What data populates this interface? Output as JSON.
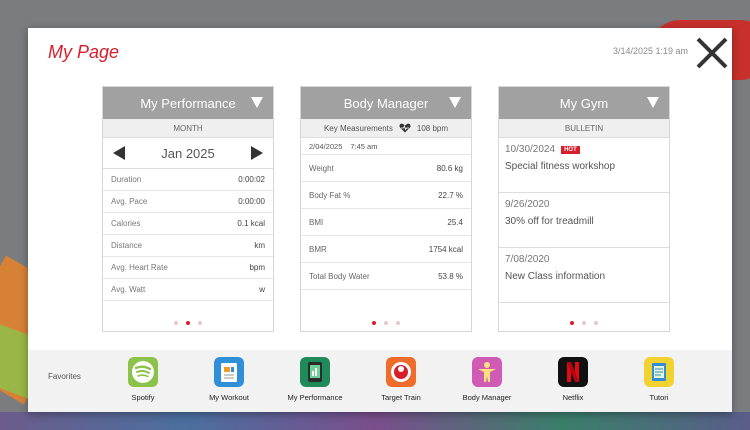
{
  "modal": {
    "title": "My Page",
    "datetime": "3/14/2025 1:19 am"
  },
  "performance": {
    "title": "My Performance",
    "subheader": "MONTH",
    "month": "Jan 2025",
    "rows": [
      {
        "label": "Duration",
        "value": "0:00:02"
      },
      {
        "label": "Avg. Pace",
        "value": "0:00:00"
      },
      {
        "label": "Calories",
        "value": "0.1 kcal"
      },
      {
        "label": "Distance",
        "value": "km"
      },
      {
        "label": "Avg. Heart Rate",
        "value": "bpm"
      },
      {
        "label": "Avg. Watt",
        "value": "w"
      }
    ],
    "page": 2,
    "pages": 3
  },
  "body": {
    "title": "Body Manager",
    "key_label": "Key Measurements",
    "heart_rate": "108 bpm",
    "date": "2/04/2025",
    "time": "7:45 am",
    "rows": [
      {
        "label": "Weight",
        "value": "80.6 kg"
      },
      {
        "label": "Body Fat %",
        "value": "22.7 %"
      },
      {
        "label": "BMI",
        "value": "25.4"
      },
      {
        "label": "BMR",
        "value": "1754 kcal"
      },
      {
        "label": "Total Body Water",
        "value": "53.8 %"
      }
    ],
    "page": 1,
    "pages": 3
  },
  "gym": {
    "title": "My Gym",
    "subheader": "BULLETIN",
    "hot_label": "HOT",
    "items": [
      {
        "date": "10/30/2024",
        "text": "Special fitness workshop"
      },
      {
        "date": "9/26/2020",
        "text": "30% off for treadmill"
      },
      {
        "date": "7/08/2020",
        "text": "New Class information"
      }
    ],
    "page": 1,
    "pages": 3
  },
  "favorites": {
    "label": "Favorites",
    "apps": [
      {
        "label": "Spotify",
        "icon": "spotify-icon",
        "color": "#8bc34a"
      },
      {
        "label": "My Workout",
        "icon": "clipboard-icon",
        "color": "#2f8fd8"
      },
      {
        "label": "My Performance",
        "icon": "tablet-icon",
        "color": "#1f8a5a"
      },
      {
        "label": "Target Train",
        "icon": "target-train-icon",
        "color": "#ef6c2c"
      },
      {
        "label": "Body Manager",
        "icon": "body-icon",
        "color": "#d05bb5"
      },
      {
        "label": "Netflix",
        "icon": "netflix-icon",
        "color": "#111111"
      },
      {
        "label": "Tutori",
        "icon": "tutorial-icon",
        "color": "#f2d22e"
      }
    ]
  },
  "colors": {
    "accent": "#d71e2a",
    "card_header": "#a1a1a1"
  }
}
